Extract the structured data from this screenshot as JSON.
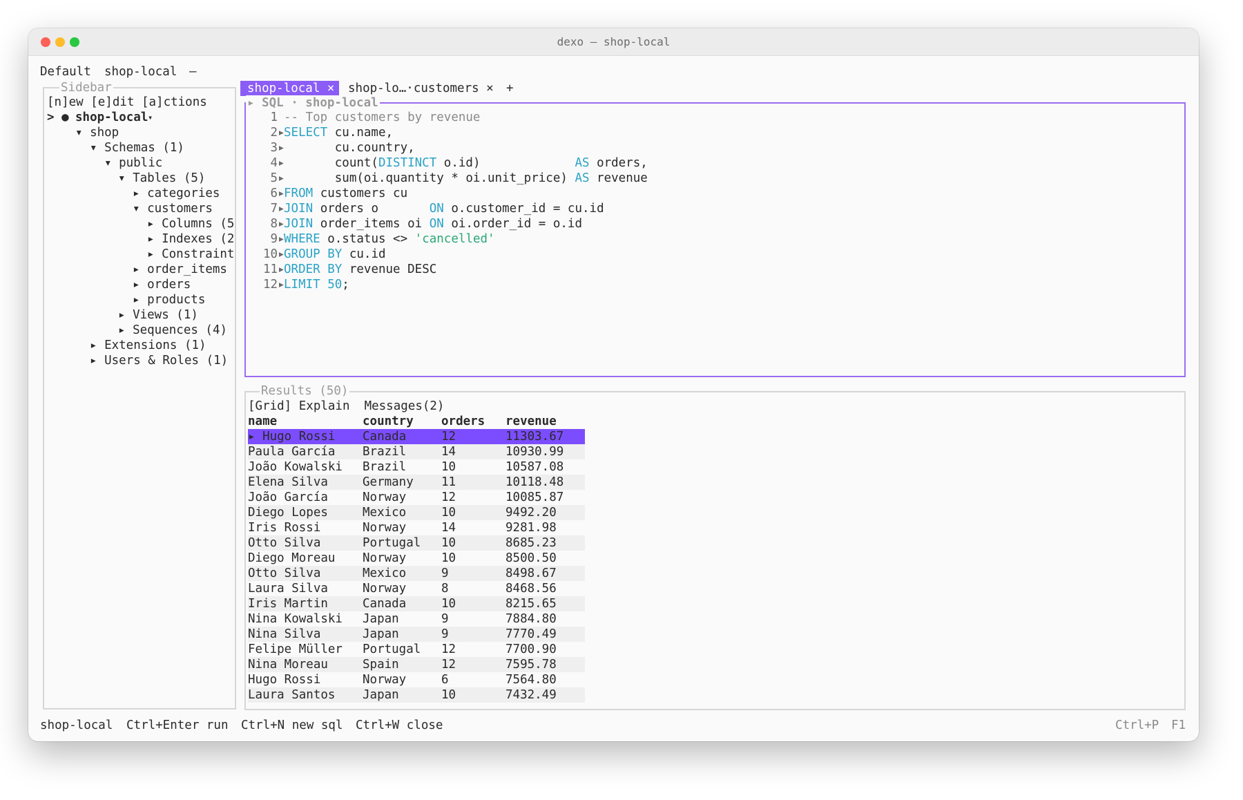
{
  "window": {
    "title": "dexo — shop-local"
  },
  "header": {
    "profile": "Default",
    "connection": "shop-local",
    "dash": "—"
  },
  "sidebar": {
    "title": "Sidebar",
    "menu": "[n]ew [e]dit [a]ctions",
    "connection_prefix": "> ●",
    "connection_name": "shop-local",
    "connection_marker": "▾",
    "tree": {
      "shop": "▾ shop",
      "schemas": "▾ Schemas (1)",
      "public": "▾ public",
      "tables": "▾ Tables (5)",
      "categories": "▸ categories",
      "customers": "▾ customers",
      "columns": "▸ Columns (5",
      "indexes": "▸ Indexes (2",
      "constraints": "▸ Constraint",
      "order_items": "▸ order_items",
      "orders": "▸ orders",
      "products": "▸ products",
      "views": "▸ Views (1)",
      "sequences": "▸ Sequences (4)",
      "extensions": "▸ Extensions (1)",
      "users_roles": "▸ Users & Roles (1)"
    }
  },
  "tabs": {
    "active": "shop-local ×",
    "second": "shop-lo…·customers ×",
    "add": "+"
  },
  "editor": {
    "title": "▸ SQL · shop-local",
    "lines": {
      "l1_num": " 1",
      "l1_comment": "-- Top customers by revenue",
      "l2_num": " 2▸",
      "l2_kw": "SELECT",
      "l2_rest": " cu.name,",
      "l3_num": " 3▸",
      "l3_rest": "       cu.country,",
      "l4_num": " 4▸",
      "l4_a": "       count(",
      "l4_kw": "DISTINCT",
      "l4_b": " o.id)             ",
      "l4_as": "AS",
      "l4_c": " orders,",
      "l5_num": " 5▸",
      "l5_a": "       sum(oi.quantity * oi.unit_price) ",
      "l5_as": "AS",
      "l5_c": " revenue",
      "l6_num": " 6▸",
      "l6_kw": "FROM",
      "l6_rest": " customers cu",
      "l7_num": " 7▸",
      "l7_kw": "JOIN",
      "l7_a": " orders o       ",
      "l7_on": "ON",
      "l7_b": " o.customer_id = cu.id",
      "l8_num": " 8▸",
      "l8_kw": "JOIN",
      "l8_a": " order_items oi ",
      "l8_on": "ON",
      "l8_b": " oi.order_id = o.id",
      "l9_num": " 9▸",
      "l9_kw": "WHERE",
      "l9_a": " o.status <> ",
      "l9_str": "'cancelled'",
      "l10_num": "10▸",
      "l10_kw": "GROUP BY",
      "l10_rest": " cu.id",
      "l11_num": "11▸",
      "l11_kw": "ORDER BY",
      "l11_rest": " revenue DESC",
      "l12_num": "12▸",
      "l12_kw": "LIMIT",
      "l12_num_val": " 50",
      "l12_end": ";"
    }
  },
  "results": {
    "title": "Results (50)",
    "views": "[Grid] Explain  Messages(2)",
    "columns": [
      "name",
      "country",
      "orders",
      "revenue"
    ],
    "rows": [
      [
        "▸ Hugo Rossi",
        "Canada",
        "12",
        "11303.67"
      ],
      [
        "Paula García",
        "Brazil",
        "14",
        "10930.99"
      ],
      [
        "João Kowalski",
        "Brazil",
        "10",
        "10587.08"
      ],
      [
        "Elena Silva",
        "Germany",
        "11",
        "10118.48"
      ],
      [
        "João García",
        "Norway",
        "12",
        "10085.87"
      ],
      [
        "Diego Lopes",
        "Mexico",
        "10",
        "9492.20"
      ],
      [
        "Iris Rossi",
        "Norway",
        "14",
        "9281.98"
      ],
      [
        "Otto Silva",
        "Portugal",
        "10",
        "8685.23"
      ],
      [
        "Diego Moreau",
        "Norway",
        "10",
        "8500.50"
      ],
      [
        "Otto Silva",
        "Mexico",
        "9",
        "8498.67"
      ],
      [
        "Laura Silva",
        "Norway",
        "8",
        "8468.56"
      ],
      [
        "Iris Martin",
        "Canada",
        "10",
        "8215.65"
      ],
      [
        "Nina Kowalski",
        "Japan",
        "9",
        "7884.80"
      ],
      [
        "Nina Silva",
        "Japan",
        "9",
        "7770.49"
      ],
      [
        "Felipe Müller",
        "Portugal",
        "12",
        "7700.90"
      ],
      [
        "Nina Moreau",
        "Spain",
        "12",
        "7595.78"
      ],
      [
        "Hugo Rossi",
        "Norway",
        "6",
        "7564.80"
      ],
      [
        "Laura Santos",
        "Japan",
        "10",
        "7432.49"
      ]
    ]
  },
  "statusbar": {
    "connection": "shop-local",
    "run": "Ctrl+Enter run",
    "new_sql": "Ctrl+N new sql",
    "close": "Ctrl+W close",
    "palette": "Ctrl+P",
    "help": "F1"
  },
  "colors": {
    "accent": "#8b5cf6",
    "keyword": "#2aa3c7",
    "string": "#2aa876",
    "selected_row": "#7c4dff"
  }
}
